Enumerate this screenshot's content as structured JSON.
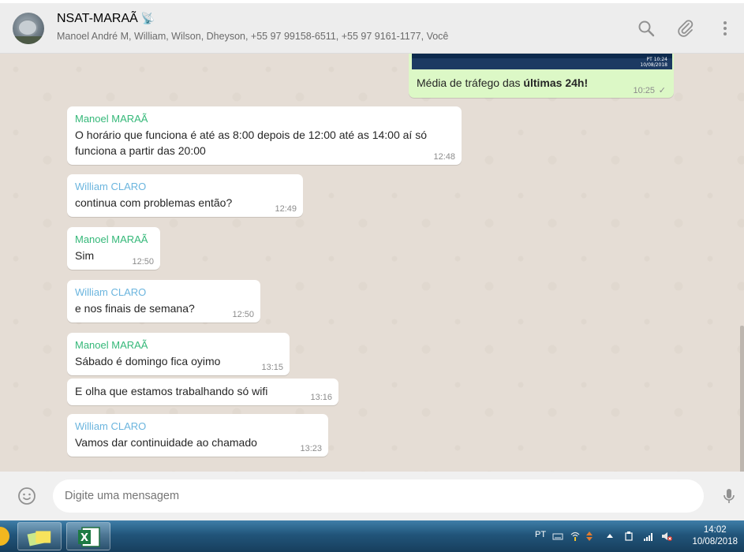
{
  "header": {
    "title": "NSAT-MARAÃ",
    "title_icon": "satellite-dish-emoji",
    "participants": "Manoel André M, William, Wilson, Dheyson, +55 97 99158-6511, +55 97 9161-1177, Você",
    "icons": [
      "search-icon",
      "attach-icon",
      "menu-icon"
    ]
  },
  "outgoing_image_message": {
    "caption_prefix": "Média de tráfego das ",
    "caption_bold": "últimas 24h!",
    "time": "10:25",
    "thumbnail_tray_text": "PT",
    "thumbnail_clock_time": "10:24",
    "thumbnail_clock_date": "10/08/2018"
  },
  "messages": [
    {
      "sender": "Manoel MARAÃ",
      "sender_color": "#35b879",
      "text": "O horário que funciona é até as 8:00 depois de 12:00 até as 14:00 aí só funciona a partir das 20:00",
      "time": "12:48"
    },
    {
      "sender": "William CLARO",
      "sender_color": "#6bb5de",
      "text": "continua com problemas então?",
      "time": "12:49"
    },
    {
      "sender": "Manoel MARAÃ",
      "sender_color": "#35b879",
      "text": "Sim",
      "time": "12:50"
    },
    {
      "sender": "William CLARO",
      "sender_color": "#6bb5de",
      "text": "e nos finais de semana?",
      "time": "12:50"
    },
    {
      "sender": "Manoel MARAÃ",
      "sender_color": "#35b879",
      "text": "Sábado é domingo fica oyimo",
      "time": "13:15"
    },
    {
      "sender": "",
      "sender_color": "#35b879",
      "text": "E olha que estamos trabalhando só wifi",
      "time": "13:16"
    },
    {
      "sender": "William CLARO",
      "sender_color": "#6bb5de",
      "text": "Vamos dar continuidade ao chamado",
      "time": "13:23"
    }
  ],
  "composer": {
    "placeholder": "Digite uma mensagem",
    "icons": [
      "emoji-icon",
      "microphone-icon"
    ]
  },
  "taskbar": {
    "apps": [
      "sticky-notes-icon",
      "excel-icon"
    ],
    "language": "PT",
    "tray_icons": [
      "keyboard-icon",
      "network-icon",
      "up-arrow-icon",
      "usb-icon",
      "signal-icon",
      "volume-muted-icon"
    ],
    "clock_time": "14:02",
    "clock_date": "10/08/2018"
  }
}
